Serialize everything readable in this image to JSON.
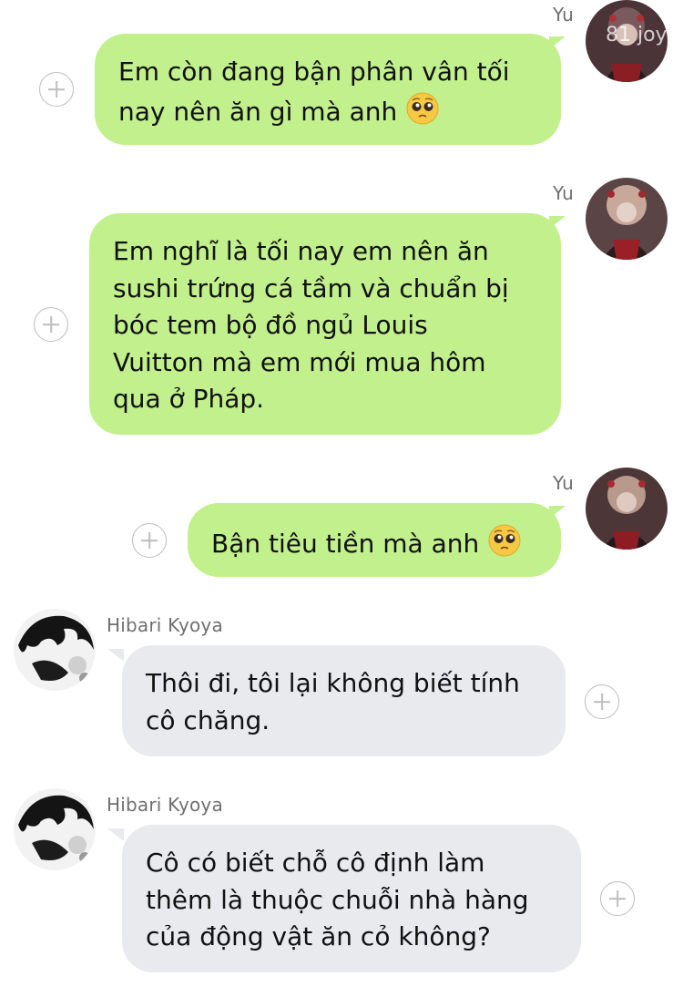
{
  "messages": [
    {
      "sender": "Yu",
      "lines": [
        "Em còn đang bận phân vân tối",
        "nay nên ăn gì mà anh"
      ],
      "emoji": "pleading-face"
    },
    {
      "sender": "Yu",
      "lines": [
        "Em nghĩ là tối nay em nên ăn",
        "sushi trứng cá tầm và chuẩn bị",
        "bóc tem bộ đồ ngủ Louis",
        "Vuitton mà em mới mua hôm",
        "qua ở Pháp."
      ]
    },
    {
      "sender": "Yu",
      "lines": [
        "Bận tiêu tiền mà anh"
      ],
      "emoji": "pleading-face"
    },
    {
      "sender": "Hibari Kyoya",
      "lines": [
        "Thôi đi, tôi lại không biết tính",
        "cô chăng."
      ]
    },
    {
      "sender": "Hibari Kyoya",
      "lines": [
        "Cô có biết chỗ cô định làm",
        "thêm là thuộc chuỗi nhà hàng",
        "của động vật ăn cỏ không?"
      ]
    }
  ],
  "watermark": "81 joy",
  "colors": {
    "outgoing": "#c1f08c",
    "incoming": "#e8eaee",
    "plus": "#bdbdbd"
  },
  "icons": {
    "add": "plus-circle-icon",
    "emoji": "pleading-face-icon"
  }
}
